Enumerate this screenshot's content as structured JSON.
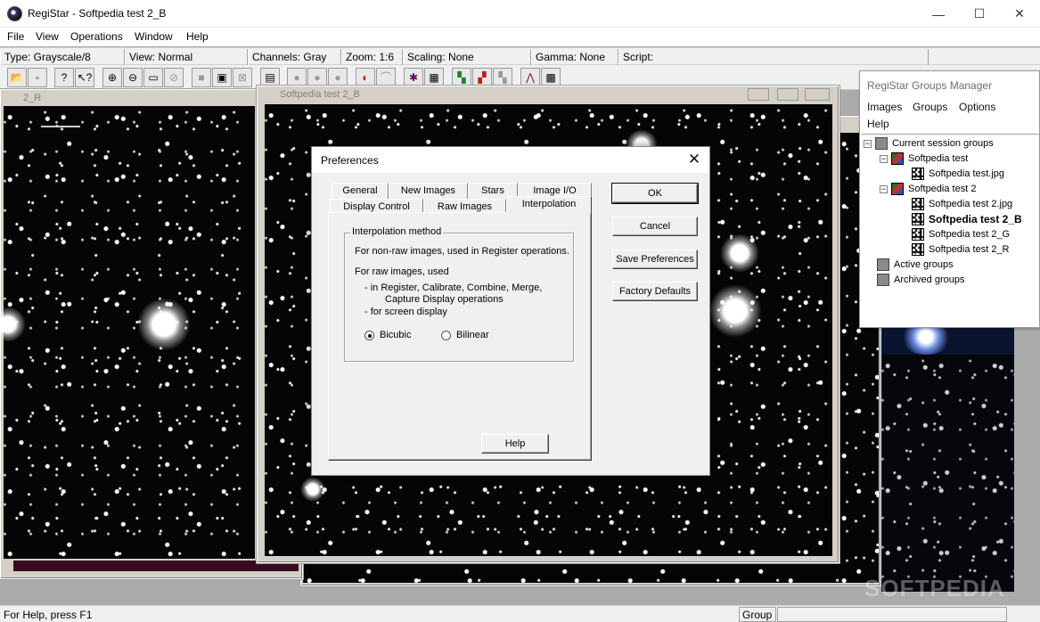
{
  "window": {
    "title": "RegiStar - Softpedia test 2_B",
    "controls": {
      "minimize": "—",
      "maximize": "☐",
      "close": "✕"
    }
  },
  "menu": [
    "File",
    "View",
    "Operations",
    "Window",
    "Help"
  ],
  "infobar": {
    "type": "Type: Grayscale/8",
    "view": "View: Normal",
    "channels": "Channels: Gray",
    "zoom": "Zoom: 1:6",
    "scaling": "Scaling: None",
    "gamma": "Gamma: None",
    "script": "Script:"
  },
  "toolbar_icons": [
    "open-icon",
    "save-icon",
    "help-icon",
    "context-help-icon",
    "zoom-in-icon",
    "zoom-out-icon",
    "zoom-fit-icon",
    "zoom-off-icon",
    "stop-icon",
    "monitor-icon",
    "crop-icon",
    "script-icon",
    "circle-1-icon",
    "circle-2-icon",
    "circle-3-icon",
    "register-icon",
    "curve-icon",
    "stars-icon",
    "grid-icon",
    "rgb-icon",
    "color-icon",
    "gray-icon",
    "histogram-icon",
    "pattern-icon"
  ],
  "mdi": {
    "left_title": "2_R",
    "center_title": "Softpedia test 2_B"
  },
  "groups_manager": {
    "title": "RegiStar Groups Manager",
    "menu": [
      "Images",
      "Groups",
      "Options",
      "Help"
    ],
    "tree": {
      "current": "Current session groups",
      "group1": "Softpedia test",
      "group1_img": "Softpedia test.jpg",
      "group2": "Softpedia test 2",
      "group2_img1": "Softpedia test 2.jpg",
      "group2_img2": "Softpedia test 2_B",
      "group2_img3": "Softpedia test 2_G",
      "group2_img4": "Softpedia test 2_R",
      "active": "Active groups",
      "archived": "Archived groups"
    }
  },
  "dialog": {
    "title": "Preferences",
    "close": "✕",
    "tabs_back": [
      "General",
      "New Images",
      "Stars",
      "Image I/O"
    ],
    "tabs_front": [
      "Display Control",
      "Raw Images",
      "Interpolation"
    ],
    "active_tab": "Interpolation",
    "group_title": "Interpolation method",
    "line1": "For non-raw images, used in Register operations.",
    "line2": "For raw images, used",
    "line3": "- in Register, Calibrate, Combine, Merge,",
    "line4": "Capture Display operations",
    "line5": "- for screen display",
    "radio_bicubic": "Bicubic",
    "radio_bilinear": "Bilinear",
    "selected": "Bicubic",
    "help": "Help",
    "ok": "OK",
    "cancel": "Cancel",
    "save": "Save Preferences",
    "defaults": "Factory Defaults"
  },
  "status": {
    "help": "For Help, press F1",
    "group": "Group"
  },
  "watermark": "SOFTPEDIA"
}
